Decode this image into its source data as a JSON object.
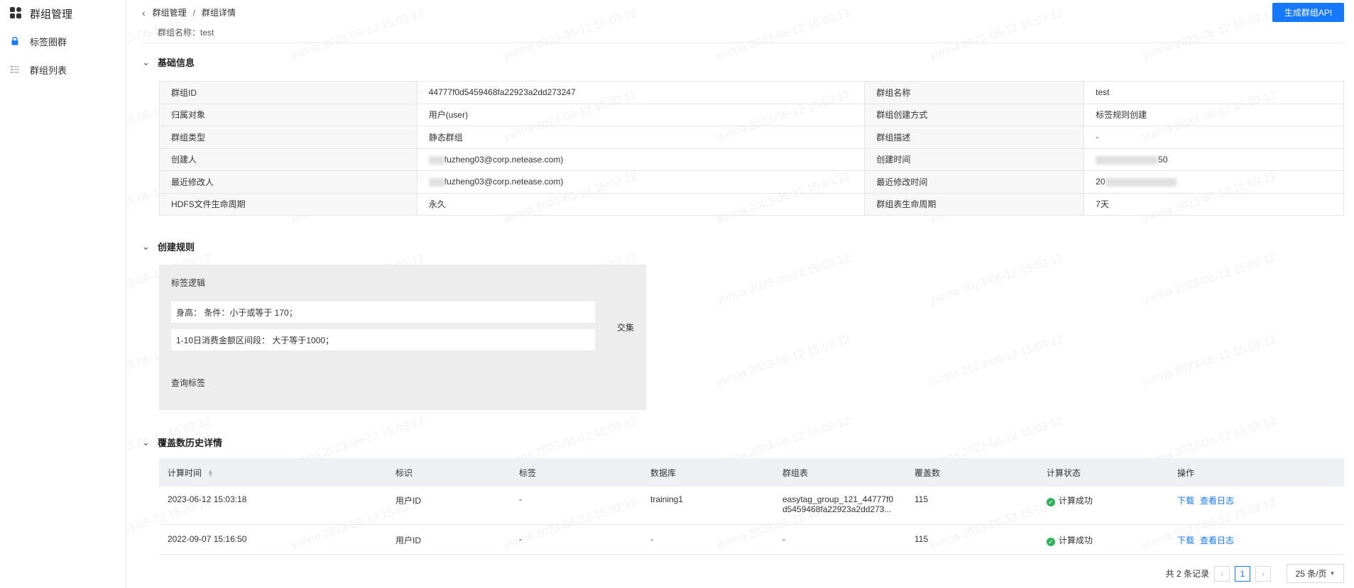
{
  "sidebar": {
    "app_title": "群组管理",
    "items": [
      {
        "label": "标签圈群",
        "icon": "lock-icon"
      },
      {
        "label": "群组列表",
        "icon": "list-icon"
      }
    ]
  },
  "header": {
    "breadcrumb": [
      "群组管理",
      "群组详情"
    ],
    "group_name": "群组名称：test",
    "api_button": "生成群组API"
  },
  "sections": {
    "basic": "基础信息",
    "rules": "创建规则",
    "history": "覆盖数历史详情"
  },
  "basic_info": {
    "rows": [
      {
        "l1": "群组ID",
        "v1": "44777f0d5459468fa22923a2dd273247",
        "l2": "群组名称",
        "v2": "test"
      },
      {
        "l1": "归属对象",
        "v1": "用户(user)",
        "l2": "群组创建方式",
        "v2": "标签规则创建"
      },
      {
        "l1": "群组类型",
        "v1": "静态群组",
        "l2": "群组描述",
        "v2": "-"
      },
      {
        "l1": "创建人",
        "v1": "fuzheng03@corp.netease.com)",
        "l2": "创建时间",
        "v2": "50"
      },
      {
        "l1": "最近修改人",
        "v1": "fuzheng03@corp.netease.com)",
        "l2": "最近修改时间",
        "v2": "20"
      },
      {
        "l1": "HDFS文件生命周期",
        "v1": "永久",
        "l2": "群组表生命周期",
        "v2": "7天"
      }
    ]
  },
  "rules": {
    "title": "标签逻辑",
    "items": [
      "身高：  条件：小于或等于 170；",
      "1-10日消费金额区间段：  大于等于1000；"
    ],
    "logic": "交集",
    "query_tag": "查询标签"
  },
  "history": {
    "columns": [
      "计算时间",
      "标识",
      "标签",
      "数据库",
      "群组表",
      "覆盖数",
      "计算状态",
      "操作"
    ],
    "rows": [
      {
        "time": "2023-06-12 15:03:18",
        "id": "用户ID",
        "tag": "-",
        "db": "training1",
        "table1": "easytag_group_121_44777f0",
        "table2": "d5459468fa22923a2dd273...",
        "count": "115",
        "status": "计算成功",
        "download": "下载",
        "log": "查看日志"
      },
      {
        "time": "2022-09-07 15:16:50",
        "id": "用户ID",
        "tag": "-",
        "db": "-",
        "table1": "-",
        "table2": "",
        "count": "115",
        "status": "计算成功",
        "download": "下载",
        "log": "查看日志"
      }
    ]
  },
  "pagination": {
    "total": "共 2 条记录",
    "current": "1",
    "page_size": "25 条/页"
  },
  "watermark": "yunna 2023-06-12 15:03:12",
  "colors": {
    "primary": "#1677ff",
    "success": "#2fb15a"
  }
}
